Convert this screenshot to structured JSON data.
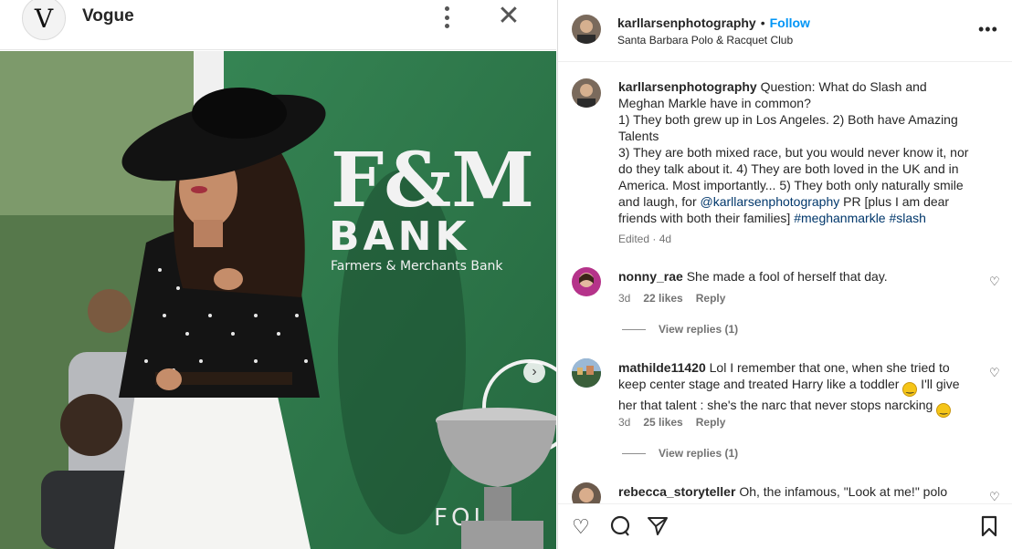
{
  "left": {
    "brand": "Vogue",
    "logo_letter": "V",
    "icons": {
      "more": "more-vertical-icon",
      "close": "close-icon",
      "next": "chevron-right-icon"
    }
  },
  "post": {
    "username": "karllarsenphotography",
    "separator": "•",
    "follow": "Follow",
    "location": "Santa Barbara Polo & Racquet Club",
    "caption_user": "karllarsenphotography",
    "caption_lines": [
      "Question: What do Slash and Meghan Markle have in common?",
      "1) They both grew up in Los Angeles. 2) Both have Amazing Talents",
      "3) They are both mixed race, but you would never know it, nor do they talk about it. 4) They are both loved in the UK and in America. Most importantly... 5) They both only naturally smile and laugh, for "
    ],
    "caption_mention": "@karllarsenphotography",
    "caption_after_mention": " PR [plus I am dear friends with both their families] ",
    "hashtag1": "#meghanmarkle",
    "hashtag2": "#slash",
    "edited": "Edited · 4d"
  },
  "comments": [
    {
      "user": "nonny_rae",
      "text": "She made a fool of herself that day.",
      "age": "3d",
      "likes": "22 likes",
      "reply": "Reply",
      "view_replies": "View replies (1)"
    },
    {
      "user": "mathilde11420",
      "text_a": "Lol I remember that one, when she tried to keep center stage and treated Harry like a toddler",
      "text_b": " I'll give her that talent : she's the narc that never stops narcking",
      "age": "3d",
      "likes": "25 likes",
      "reply": "Reply",
      "view_replies": "View replies (1)"
    },
    {
      "user": "rebecca_storyteller",
      "text": "Oh, the infamous, \"Look at me!\" polo"
    }
  ],
  "photo_text": {
    "bank_fm": "F&M",
    "bank": "BANK",
    "bank_sub": "Farmers & Merchants Bank",
    "fold": "FOLD"
  },
  "actions": [
    "heart-icon",
    "comment-icon",
    "share-icon",
    "bookmark-icon"
  ],
  "colors": {
    "accent": "#0095f6",
    "link": "#00376b",
    "green_backdrop": "#2f7c4d"
  }
}
